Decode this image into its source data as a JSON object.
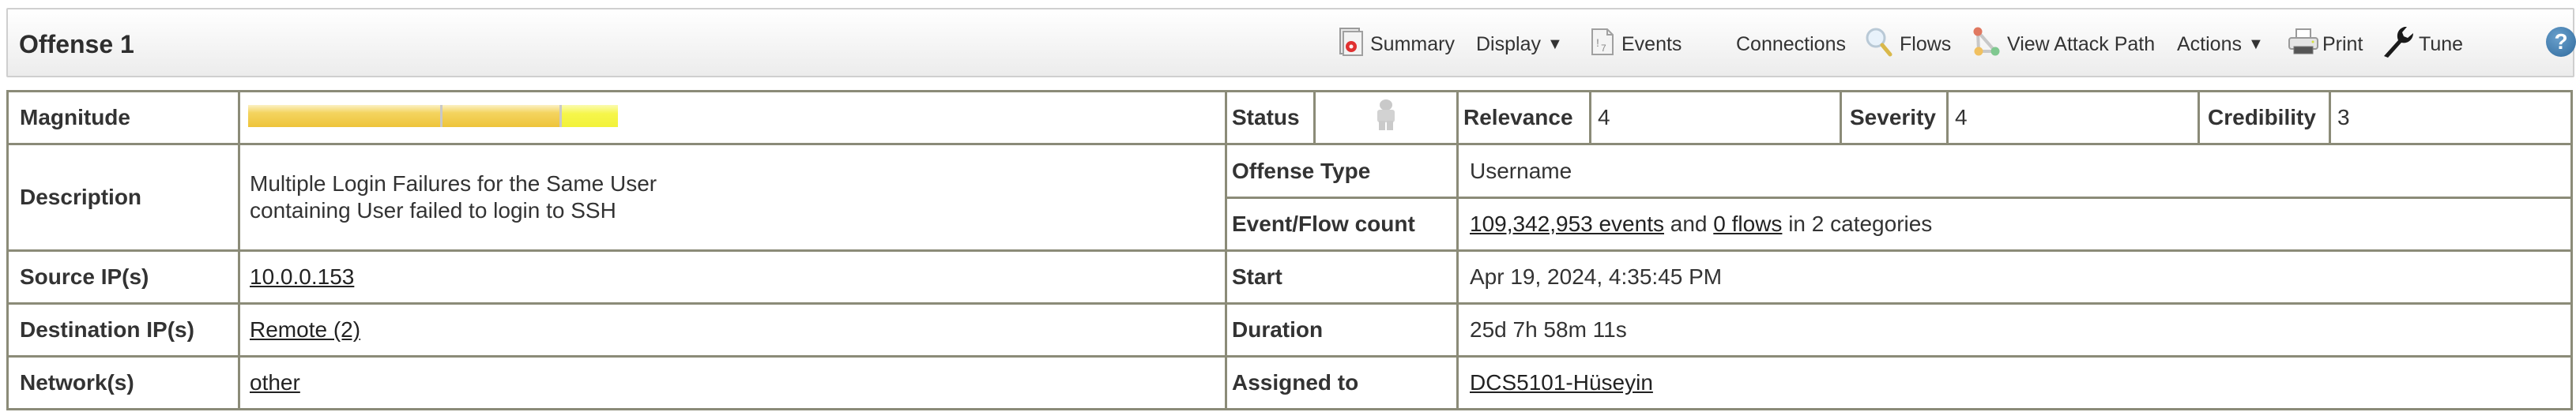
{
  "header": {
    "title": "Offense 1",
    "toolbar": [
      {
        "label": "Summary",
        "icon": "summary-icon"
      },
      {
        "label": "Display",
        "icon": "caret-down-icon",
        "dropdown": true
      },
      {
        "label": "Events",
        "icon": "events-icon"
      },
      {
        "label": "Connections"
      },
      {
        "label": "Flows",
        "icon": "magnifier-icon"
      },
      {
        "label": "View Attack Path",
        "icon": "attack-path-icon"
      },
      {
        "label": "Actions",
        "icon": "caret-down-icon",
        "dropdown": true
      },
      {
        "label": "Print",
        "icon": "printer-icon"
      },
      {
        "label": "Tune",
        "icon": "wrench-icon"
      }
    ],
    "caret": "▼",
    "help_icon": "help-icon",
    "help_glyph": "?"
  },
  "details": {
    "magnitude": {
      "label": "Magnitude",
      "segments": [
        {
          "name": "relevance",
          "value": 4,
          "color": "#eec43a"
        },
        {
          "name": "severity",
          "value": 4,
          "color": "#eec43a"
        },
        {
          "name": "credibility",
          "value": 3,
          "color": "#f6f64a"
        }
      ],
      "scale_max": 10
    },
    "status": {
      "label": "Status",
      "icon": "person-icon"
    },
    "relevance": {
      "label": "Relevance",
      "value": "4"
    },
    "severity": {
      "label": "Severity",
      "value": "4"
    },
    "credibility": {
      "label": "Credibility",
      "value": "3"
    },
    "description": {
      "label": "Description",
      "line1": "Multiple Login Failures for the Same User",
      "line2": "containing User failed to login to SSH"
    },
    "offense_type": {
      "label": "Offense Type",
      "value": "Username"
    },
    "event_flow_count": {
      "label": "Event/Flow count",
      "events_link": "109,342,953 events",
      "and_text": " and ",
      "flows_link": "0 flows",
      "suffix": " in 2 categories"
    },
    "source_ips": {
      "label": "Source IP(s)",
      "value": "10.0.0.153"
    },
    "start": {
      "label": "Start",
      "value": "Apr 19, 2024, 4:35:45 PM"
    },
    "destination_ips": {
      "label": "Destination IP(s)",
      "value": "Remote (2)"
    },
    "duration": {
      "label": "Duration",
      "value": "25d 7h 58m 11s"
    },
    "networks": {
      "label": "Network(s)",
      "value": "other"
    },
    "assigned_to": {
      "label": "Assigned to",
      "value": "DCS5101-Hüseyin"
    }
  }
}
